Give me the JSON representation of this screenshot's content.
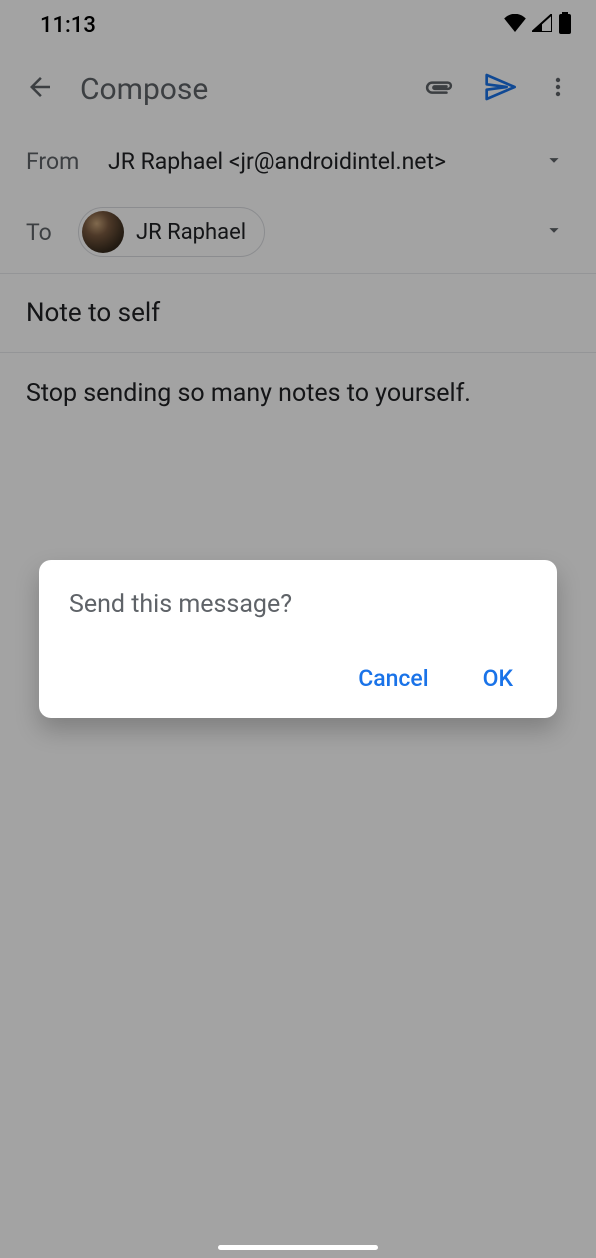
{
  "status": {
    "time": "11:13"
  },
  "appbar": {
    "title": "Compose"
  },
  "from": {
    "label": "From",
    "value": "JR Raphael  <jr@androidintel.net>"
  },
  "to": {
    "label": "To",
    "chip_name": "JR Raphael"
  },
  "subject": "Note to self",
  "body": "Stop sending so many notes to yourself.",
  "dialog": {
    "title": "Send this message?",
    "cancel": "Cancel",
    "ok": "OK"
  },
  "colors": {
    "accent": "#1a73e8",
    "text_primary": "#202124",
    "text_secondary": "#5f6368"
  }
}
